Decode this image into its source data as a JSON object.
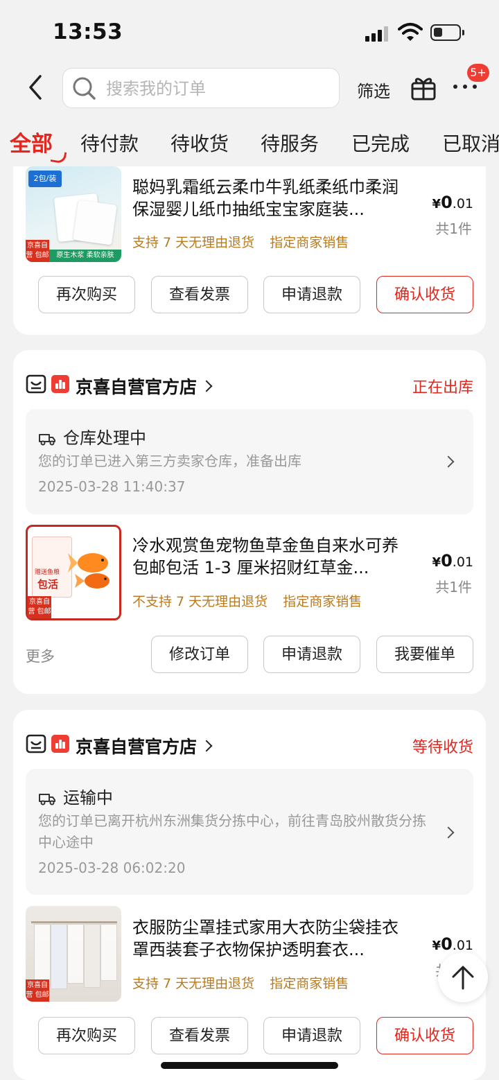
{
  "status_bar": {
    "time": "13:53"
  },
  "search": {
    "placeholder": "搜索我的订单"
  },
  "header": {
    "filter_label": "筛选",
    "badge": "5+"
  },
  "tabs": [
    "全部",
    "待付款",
    "待收货",
    "待服务",
    "已完成",
    "已取消"
  ],
  "orders": [
    {
      "product": {
        "title": "聪妈乳霜纸云柔巾牛乳纸柔纸巾柔润保湿婴儿纸巾抽纸宝宝家庭装...",
        "tags": [
          "支持 7 天无理由退货",
          "指定商家销售"
        ],
        "price_int": "0",
        "price_dec": ".01",
        "currency": "¥",
        "count": "共1件",
        "image_text": {
          "top": "2包/装",
          "tag": "京喜自营\n包邮",
          "bottom": "原生木浆 柔软亲肤"
        }
      },
      "buttons": [
        "再次购买",
        "查看发票",
        "申请退款",
        "确认收货"
      ]
    },
    {
      "shop": "京喜自营官方店",
      "status": "正在出库",
      "tracking": {
        "title": "仓库处理中",
        "desc": "您的订单已进入第三方卖家仓库，准备出库",
        "time": "2025-03-28 11:40:37"
      },
      "product": {
        "title": "冷水观赏鱼宠物鱼草金鱼自来水可养包邮包活 1-3 厘米招财红草金...",
        "tags": [
          "不支持 7 天无理由退货",
          "指定商家销售"
        ],
        "price_int": "0",
        "price_dec": ".01",
        "currency": "¥",
        "count": "共1件",
        "image_text": {
          "top": "赠送鱼粮",
          "mid": "包活",
          "tag": "京喜自营\n包邮"
        }
      },
      "more_label": "更多",
      "buttons": [
        "修改订单",
        "申请退款",
        "我要催单"
      ]
    },
    {
      "shop": "京喜自营官方店",
      "status": "等待收货",
      "tracking": {
        "title": "运输中",
        "desc": "您的订单已离开杭州东洲集货分拣中心，前往青岛胶州散货分拣中心途中",
        "time": "2025-03-28 06:02:20"
      },
      "product": {
        "title": "衣服防尘罩挂式家用大衣防尘袋挂衣罩西装套子衣物保护透明套衣...",
        "tags": [
          "支持 7 天无理由退货",
          "指定商家销售"
        ],
        "price_int": "0",
        "price_dec": ".01",
        "currency": "¥",
        "count": "共1件",
        "image_text": {
          "tag": "京喜自营\n包邮"
        }
      },
      "buttons": [
        "再次购买",
        "查看发票",
        "申请退款",
        "确认收货"
      ]
    }
  ],
  "colors": {
    "accent": "#e3261e",
    "tag_text": "#b97a1e",
    "background": "#f2f2f2"
  }
}
